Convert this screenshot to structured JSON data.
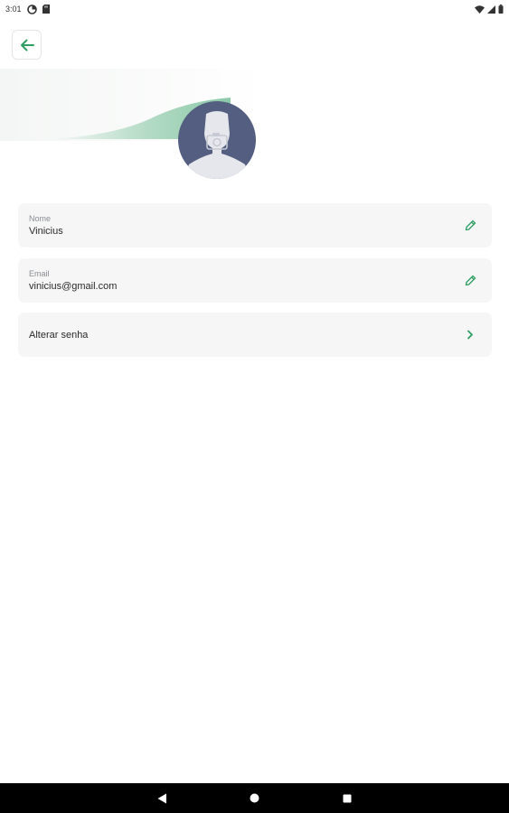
{
  "status_bar": {
    "time": "3:01"
  },
  "profile": {
    "name_label": "Nome",
    "name_value": "Vinicius",
    "email_label": "Email",
    "email_value": "vinicius@gmail.com",
    "change_password": "Alterar senha"
  },
  "icons": {
    "back": "arrow-left-icon",
    "edit": "pencil-icon",
    "chevron": "chevron-right-icon",
    "avatar": "user-silhouette-icon"
  },
  "colors": {
    "accent": "#2e9e62",
    "avatar_bg": "#535e80",
    "card_bg": "#f6f6f6",
    "nav_bg": "#000000"
  }
}
